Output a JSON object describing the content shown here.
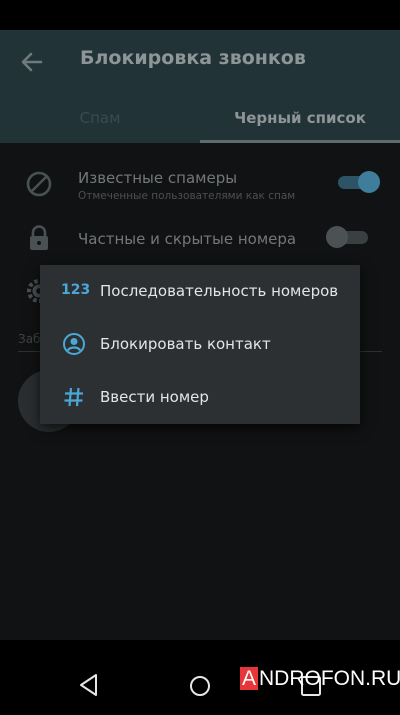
{
  "app_bar": {
    "title": "Блокировка звонков",
    "tabs": [
      {
        "label": "Спам",
        "selected": false
      },
      {
        "label": "Черный список",
        "selected": true
      }
    ]
  },
  "settings": [
    {
      "title": "Известные спамеры",
      "subtitle": "Отмеченные пользователями как спам",
      "icon": "block-icon",
      "enabled": true
    },
    {
      "title": "Частные и скрытые номера",
      "icon": "lock-icon",
      "enabled": false
    }
  ],
  "section_label": "Заб",
  "popup_menu": [
    {
      "icon": "123",
      "label": "Последовательность номеров"
    },
    {
      "icon": "account-circle-icon",
      "label": "Блокировать контакт"
    },
    {
      "icon": "hash-icon",
      "label": "Ввести номер"
    }
  ],
  "watermark": {
    "logo_letter": "A",
    "logo_text": "NDROFON.RU"
  },
  "colors": {
    "accent": "#4aa8d8",
    "appbar": "#223338",
    "menu_bg": "#2c3032",
    "watermark_red": "#e8353a"
  }
}
